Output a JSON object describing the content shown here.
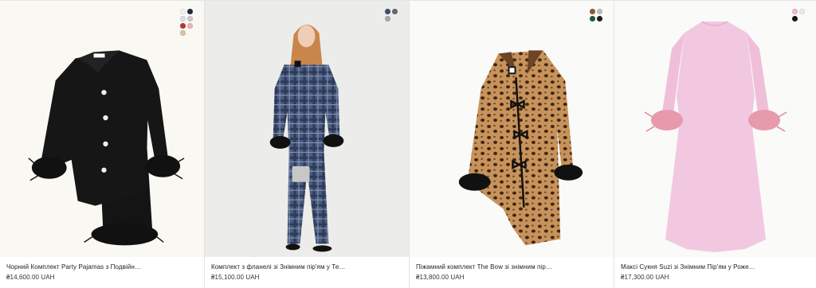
{
  "products": [
    {
      "title": "Чорний Комплект Party Pajamas з Подвійн…",
      "price": "₴14,600.00 UAH",
      "background": "#faf8f3",
      "swatches": [
        "#f1f1f1",
        "#1f2b3f",
        "#d9dee6",
        "#c9c9c9",
        "#b9382c",
        "#e9b3bd",
        "#d8c2a6"
      ]
    },
    {
      "title": "Комплект з фланелі зі Знімним пір'ям у Те…",
      "price": "₴15,100.00 UAH",
      "background": "#ececea",
      "swatches": [
        "#3f4e70",
        "#6a6a6a",
        "#a9a8a2"
      ]
    },
    {
      "title": "Піжамний комплект The Bow зі знімним пір…",
      "price": "₴13,800.00 UAH",
      "background": "#fafaf8",
      "swatches": [
        "#8a5b37",
        "#bdbdbd",
        "#1e5a35",
        "#1c1c1c"
      ]
    },
    {
      "title": "Максі Сукня Suzi зі Знімним Пір'ям у Роже…",
      "price": "₴17,300.00 UAH",
      "background": "#fafaf8",
      "swatches": [
        "#f0b8d2",
        "#e9e9e9",
        "#161616"
      ]
    }
  ]
}
